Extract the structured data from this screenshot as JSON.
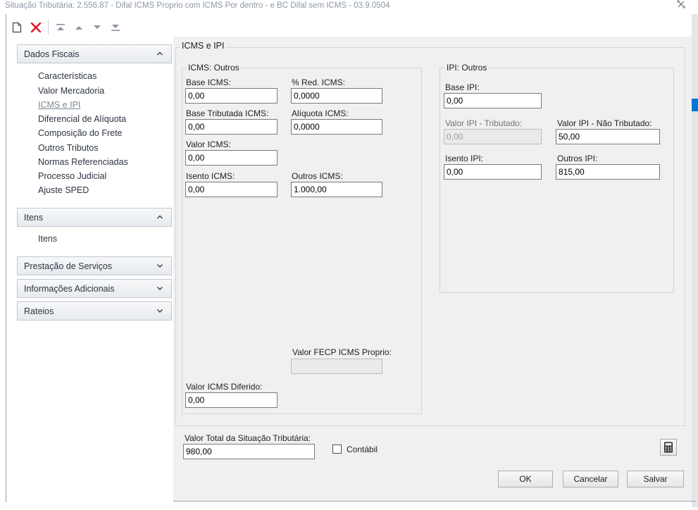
{
  "window": {
    "title": "Situação Tributária: 2.556.87 - Difal ICMS Proprio com ICMS Por dentro - e BC Difal sem ICMS - 03.9.0504",
    "close_glyph": "⤫"
  },
  "toolbar": {
    "icons": [
      "new-document-icon",
      "delete-icon",
      "move-first-icon",
      "move-up-icon",
      "move-down-icon",
      "move-last-icon"
    ]
  },
  "sidebar": {
    "sections": [
      {
        "label": "Dados Fiscais",
        "expanded": true,
        "items": [
          {
            "label": "Características"
          },
          {
            "label": "Valor Mercadoria"
          },
          {
            "label": "ICMS e IPI",
            "active": true
          },
          {
            "label": "Diferencial de Alíquota"
          },
          {
            "label": "Composição do Frete"
          },
          {
            "label": "Outros Tributos"
          },
          {
            "label": "Normas Referenciadas"
          },
          {
            "label": "Processo Judicial"
          },
          {
            "label": "Ajuste SPED"
          }
        ]
      },
      {
        "label": "Itens",
        "expanded": true,
        "items": [
          {
            "label": "Itens"
          }
        ]
      },
      {
        "label": "Prestação de Serviços",
        "expanded": false
      },
      {
        "label": "Informações Adicionais",
        "expanded": false
      },
      {
        "label": "Rateios",
        "expanded": false
      }
    ]
  },
  "main": {
    "group_title": "ICMS e IPI",
    "icms": {
      "title": "ICMS: Outros",
      "base_label": "Base ICMS:",
      "base_value": "0,00",
      "red_label": "% Red. ICMS:",
      "red_value": "0,0000",
      "base_trib_label": "Base Tributada ICMS:",
      "base_trib_value": "0,00",
      "aliquota_label": "Alíquota ICMS:",
      "aliquota_value": "0,0000",
      "valor_label": "Valor ICMS:",
      "valor_value": "0,00",
      "isento_label": "Isento ICMS:",
      "isento_value": "0,00",
      "outros_label": "Outros ICMS:",
      "outros_value": "1.000,00",
      "fecp_label": "Valor FECP ICMS Proprio:",
      "fecp_value": "",
      "diferido_label": "Valor ICMS Diferido:",
      "diferido_value": "0,00"
    },
    "ipi": {
      "title": "IPI: Outros",
      "base_label": "Base IPI:",
      "base_value": "0,00",
      "trib_label": "Valor IPI - Tributado:",
      "trib_value": "0,00",
      "nao_trib_label": "Valor IPI - Não Tributado:",
      "nao_trib_value": "50,00",
      "isento_label": "Isento IPI:",
      "isento_value": "0,00",
      "outros_label": "Outros IPI:",
      "outros_value": "815,00"
    },
    "total_label": "Valor Total da Situação Tributária:",
    "total_value": "980,00",
    "contabil_label": "Contábil",
    "contabil_checked": false
  },
  "buttons": {
    "ok": "OK",
    "cancel": "Cancelar",
    "save": "Salvar"
  },
  "colors": {
    "accent_delete": "#e81123",
    "title_text": "#8c97a3"
  }
}
